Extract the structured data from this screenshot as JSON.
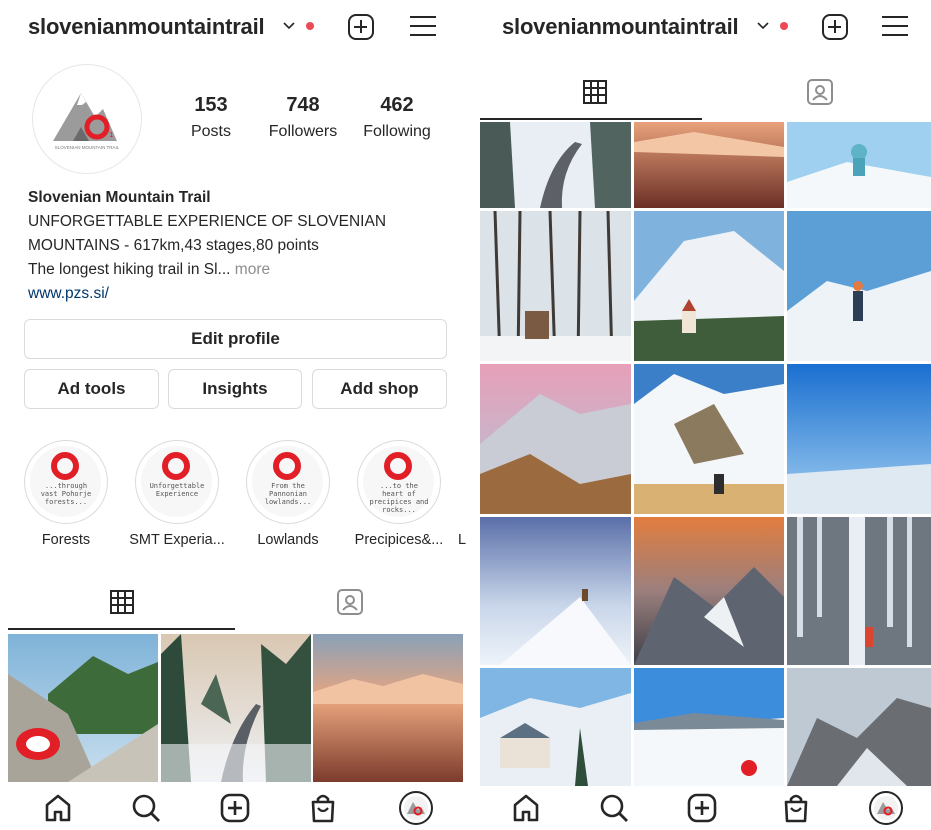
{
  "left": {
    "header": {
      "username": "slovenianmountaintrail"
    },
    "profile": {
      "avatar_text": "SLOVENIAN MOUNTAIN TRAIL",
      "stats": [
        {
          "value": "153",
          "label": "Posts"
        },
        {
          "value": "748",
          "label": "Followers"
        },
        {
          "value": "462",
          "label": "Following"
        }
      ],
      "display_name": "Slovenian Mountain Trail",
      "bio_line1": "UNFORGETTABLE EXPERIENCE OF SLOVENIAN",
      "bio_line2": "MOUNTAINS - 617km,43 stages,80 points",
      "bio_line3": "The longest hiking trail in Sl...",
      "bio_more": "more",
      "website": "www.pzs.si/"
    },
    "buttons": {
      "edit_profile": "Edit profile",
      "ad_tools": "Ad tools",
      "insights": "Insights",
      "add_shop": "Add shop"
    },
    "highlights": [
      {
        "label": "Forests",
        "cover_text": "...through vast Pohorje forests..."
      },
      {
        "label": "SMT Experia...",
        "cover_text": "Unforgettable Experience"
      },
      {
        "label": "Lowlands",
        "cover_text": "From the Pannonian lowlands..."
      },
      {
        "label": "Precipices&...",
        "cover_text": "...to the heart of precipices and rocks..."
      },
      {
        "label": "L",
        "cover_text": ""
      }
    ]
  },
  "right": {
    "header": {
      "username": "slovenianmountaintrail"
    }
  },
  "colors": {
    "accent_red": "#e21e26",
    "notification_dot": "#ed4956",
    "link": "#00376b",
    "muted": "#8e8e8e"
  },
  "icons": [
    "chevron-down-icon",
    "notification-dot",
    "new-post-icon",
    "menu-icon",
    "grid-icon",
    "tagged-icon",
    "home-icon",
    "search-icon",
    "create-icon",
    "shop-icon",
    "profile-avatar-icon"
  ]
}
